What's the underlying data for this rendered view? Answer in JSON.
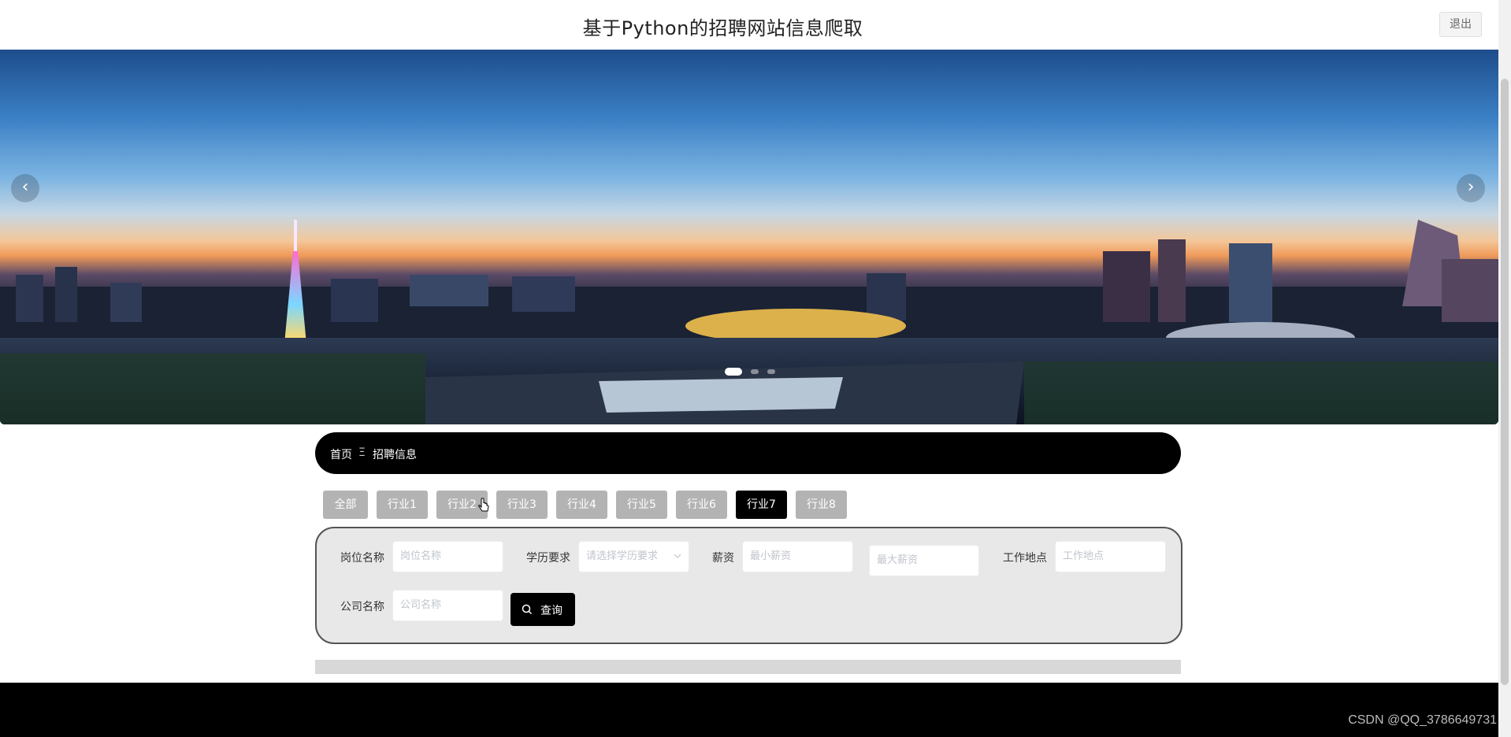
{
  "header": {
    "title": "基于Python的招聘网站信息爬取",
    "logout_label": "退出"
  },
  "carousel": {
    "prev_glyph": "‹",
    "next_glyph": "›",
    "slide_count": 3,
    "active_index": 0
  },
  "breadcrumb": {
    "home": "首页",
    "separator": "Ξ",
    "current": "招聘信息"
  },
  "industry_tabs": {
    "items": [
      "全部",
      "行业1",
      "行业2",
      "行业3",
      "行业4",
      "行业5",
      "行业6",
      "行业7",
      "行业8"
    ],
    "active": "行业7"
  },
  "search_form": {
    "job_name": {
      "label": "岗位名称",
      "placeholder": "岗位名称",
      "value": ""
    },
    "education": {
      "label": "学历要求",
      "placeholder": "请选择学历要求",
      "value": ""
    },
    "salary": {
      "label": "薪资",
      "min_placeholder": "最小薪资",
      "max_placeholder": "最大薪资"
    },
    "location": {
      "label": "工作地点",
      "placeholder": "工作地点",
      "value": ""
    },
    "company": {
      "label": "公司名称",
      "placeholder": "公司名称",
      "value": ""
    },
    "search_label": "查询"
  },
  "watermark": "CSDN @QQ_3786649731",
  "colors": {
    "accent": "#000000",
    "tab_inactive": "#b3b3b3",
    "panel_bg": "#e8e8e8"
  }
}
